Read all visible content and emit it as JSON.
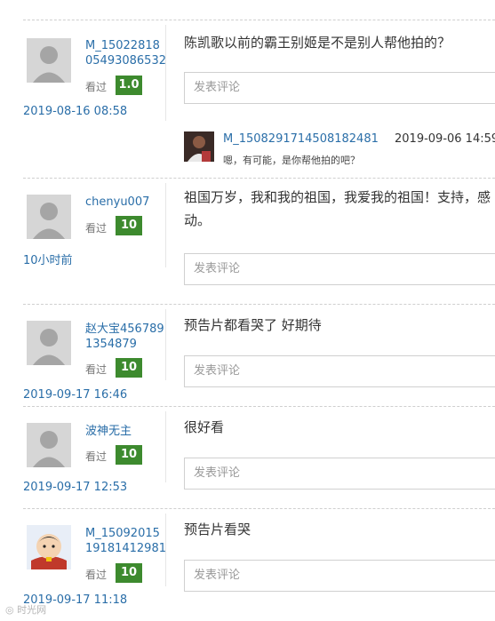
{
  "comments": [
    {
      "username": "M_1502281805493086532",
      "seen_label": "看过",
      "score": "1.0",
      "time": "2019-08-16 08:58",
      "content": "陈凯歌以前的霸王别姬是不是别人帮他拍的？",
      "reply_placeholder": "发表评论",
      "replies": [
        {
          "username": "M_1508291714508182481",
          "time": "2019-09-06 14:59",
          "text": "嗯，有可能，是你帮他拍的吧？"
        }
      ]
    },
    {
      "username": "chenyu007",
      "seen_label": "看过",
      "score": "10",
      "time": "10小时前",
      "content": "祖国万岁，我和我的祖国，我爱我的祖国！支持，感动。",
      "reply_placeholder": "发表评论"
    },
    {
      "username": "赵大宝4567891354879",
      "seen_label": "看过",
      "score": "10",
      "time": "2019-09-17 16:46",
      "content": "预告片都看哭了 好期待",
      "reply_placeholder": "发表评论"
    },
    {
      "username": "波神无主",
      "seen_label": "看过",
      "score": "10",
      "time": "2019-09-17 12:53",
      "content": "很好看",
      "reply_placeholder": "发表评论"
    },
    {
      "username": "M_1509201519181412981",
      "seen_label": "看过",
      "score": "10",
      "time": "2019-09-17 11:18",
      "content": "预告片看哭",
      "reply_placeholder": "发表评论"
    }
  ],
  "watermark": "时光网",
  "colors": {
    "link": "#2a6ea8",
    "score_bg": "#3d8a2e"
  }
}
